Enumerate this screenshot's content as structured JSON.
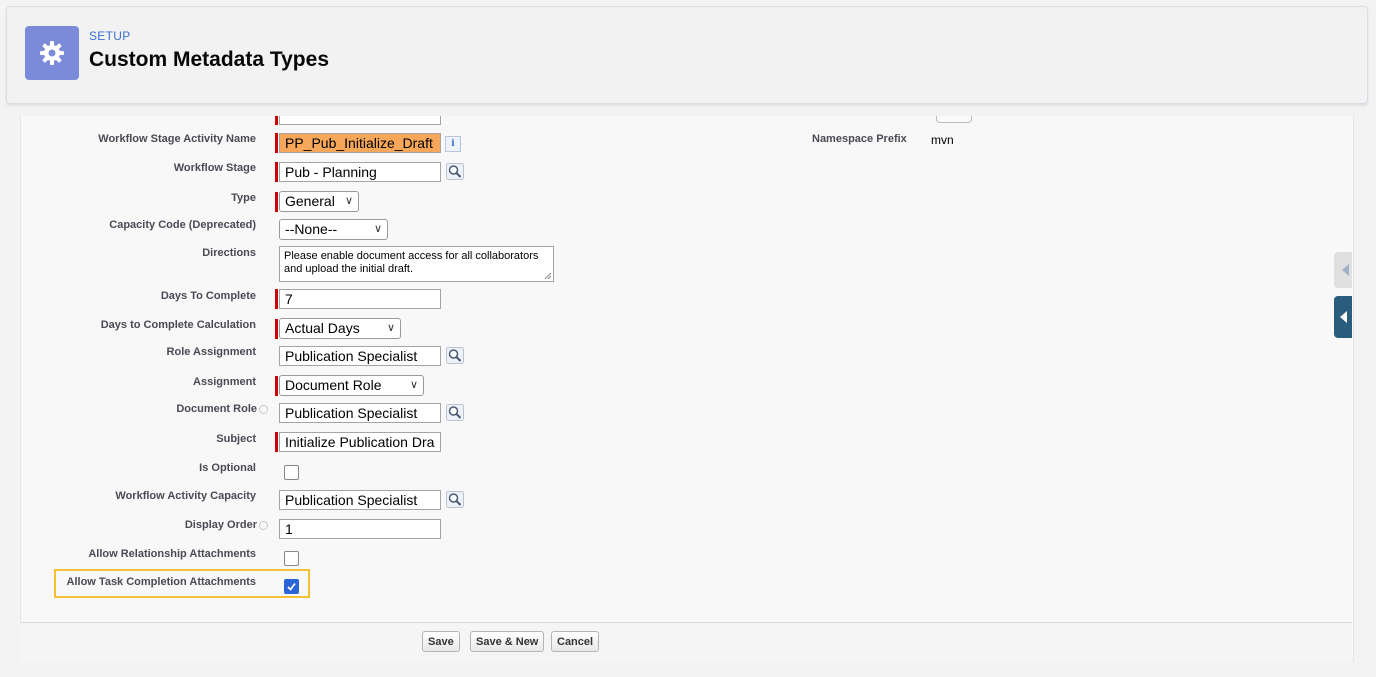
{
  "header": {
    "eyebrow": "SETUP",
    "title": "Custom Metadata Types"
  },
  "form": {
    "workflow_stage_activity_name": {
      "label": "Workflow Stage Activity Name",
      "value": "PP_Pub_Initialize_Draft"
    },
    "workflow_stage": {
      "label": "Workflow Stage",
      "value": "Pub - Planning"
    },
    "type": {
      "label": "Type",
      "value": "General"
    },
    "capacity_code": {
      "label": "Capacity Code (Deprecated)",
      "value": "--None--"
    },
    "directions": {
      "label": "Directions",
      "value": "Please enable document access for all collaborators and upload the initial draft."
    },
    "days_to_complete": {
      "label": "Days To Complete",
      "value": "7"
    },
    "days_to_complete_calc": {
      "label": "Days to Complete Calculation",
      "value": "Actual Days"
    },
    "role_assignment": {
      "label": "Role Assignment",
      "value": "Publication Specialist"
    },
    "assignment": {
      "label": "Assignment",
      "value": "Document Role"
    },
    "document_role": {
      "label": "Document Role",
      "value": "Publication Specialist"
    },
    "subject": {
      "label": "Subject",
      "value": "Initialize Publication Dra"
    },
    "is_optional": {
      "label": "Is Optional",
      "checked": false
    },
    "workflow_activity_capacity": {
      "label": "Workflow Activity Capacity",
      "value": "Publication Specialist"
    },
    "display_order": {
      "label": "Display Order",
      "value": "1"
    },
    "allow_relationship_attachments": {
      "label": "Allow Relationship Attachments",
      "checked": false
    },
    "allow_task_completion_attachments": {
      "label": "Allow Task Completion Attachments",
      "checked": true
    },
    "namespace_prefix": {
      "label": "Namespace Prefix",
      "value": "mvn"
    }
  },
  "buttons": {
    "save": "Save",
    "save_new": "Save & New",
    "cancel": "Cancel"
  },
  "colors": {
    "header_icon_bg": "#7b8bd9",
    "required_marker": "#cc0000",
    "highlight_border": "#f2c233",
    "name_field_bg": "#f6a75a",
    "checkbox_checked": "#2a66d6"
  },
  "icons": {
    "header": "gear-icon",
    "lookup": "magnifier-lookup-icon",
    "info": "info-icon"
  }
}
